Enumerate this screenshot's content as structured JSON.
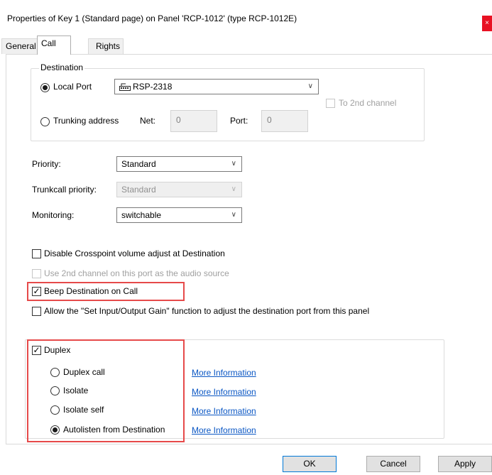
{
  "window": {
    "title": "Properties of Key 1 (Standard page) on Panel 'RCP-1012' (type RCP-1012E)",
    "close_glyph": "×"
  },
  "tabs": [
    {
      "label": "General",
      "active": false
    },
    {
      "label": "Call",
      "active": true
    },
    {
      "label": "Rights",
      "active": false
    }
  ],
  "destination": {
    "legend": "Destination",
    "local_port_label": "Local Port",
    "local_port_value": "RSP-2318",
    "local_port_selected": true,
    "trunking_label": "Trunking address",
    "net_label": "Net:",
    "net_value": "0",
    "port_label": "Port:",
    "port_value": "0",
    "second_channel_label": "To 2nd channel"
  },
  "priority": {
    "label": "Priority:",
    "value": "Standard"
  },
  "trunkcall_priority": {
    "label": "Trunkcall priority:",
    "value": "Standard"
  },
  "monitoring": {
    "label": "Monitoring:",
    "value": "switchable"
  },
  "options": {
    "disable_crosspoint": {
      "label": "Disable Crosspoint volume adjust at Destination",
      "checked": false
    },
    "use_2nd_channel": {
      "label": "Use 2nd channel on this port as the audio source",
      "checked": false
    },
    "beep_destination": {
      "label": "Beep Destination on Call",
      "checked": true
    },
    "allow_gain": {
      "label": "Allow the \"Set Input/Output Gain\" function to adjust the destination port from this panel",
      "checked": false
    }
  },
  "duplex": {
    "label": "Duplex",
    "checked": true,
    "modes": [
      {
        "label": "Duplex call",
        "selected": false,
        "link": "More Information"
      },
      {
        "label": "Isolate",
        "selected": false,
        "link": "More Information"
      },
      {
        "label": "Isolate self",
        "selected": false,
        "link": "More Information"
      },
      {
        "label": "Autolisten from Destination",
        "selected": true,
        "link": "More Information"
      }
    ]
  },
  "buttons": {
    "ok": "OK",
    "cancel": "Cancel",
    "apply": "Apply"
  },
  "icons": {
    "dropdown": "chevron-down-icon",
    "port": "device-port-icon",
    "check": "✓"
  },
  "colors": {
    "highlight": "#e64a4a",
    "link": "#0b57c4",
    "close": "#e81123"
  }
}
